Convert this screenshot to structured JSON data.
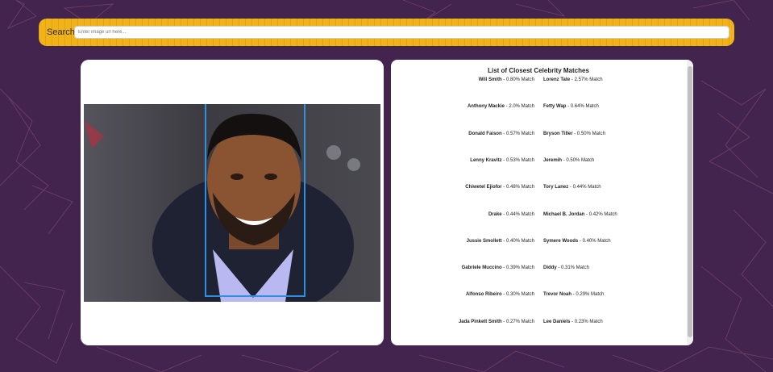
{
  "search": {
    "label": "Search",
    "placeholder": "Enter image url here..."
  },
  "photo": {
    "description_icon": "face-photo"
  },
  "results": {
    "title": "List of Closest Celebrity Matches",
    "rows": [
      [
        {
          "name": "Will Smith",
          "score": " - 0.80% Match"
        },
        {
          "name": "Lorenz Tate",
          "score": " - 2.57% Match"
        }
      ],
      [
        {
          "name": "Anthony Mackie",
          "score": " - 2.0% Match"
        },
        {
          "name": "Fetty Wap",
          "score": " - 0.64% Match"
        }
      ],
      [
        {
          "name": "Donald Faison",
          "score": " - 0.57% Match"
        },
        {
          "name": "Bryson Tiller",
          "score": " - 0.50% Match"
        }
      ],
      [
        {
          "name": "Lenny Kravitz",
          "score": " - 0.53% Match"
        },
        {
          "name": "Jeremih",
          "score": " - 0.50% Match"
        }
      ],
      [
        {
          "name": "Chiwetel Ejiofor",
          "score": " - 0.48% Match"
        },
        {
          "name": "Tory Lanez",
          "score": " - 0.44% Match"
        }
      ],
      [
        {
          "name": "Drake",
          "score": " - 0.44% Match"
        },
        {
          "name": "Michael B. Jordan",
          "score": " - 0.42% Match"
        }
      ],
      [
        {
          "name": "Jussie Smollett",
          "score": " - 0.40% Match"
        },
        {
          "name": "Symere Woods",
          "score": " - 0.40% Match"
        }
      ],
      [
        {
          "name": "Gabriele Muccino",
          "score": " - 0.39% Match"
        },
        {
          "name": "Diddy",
          "score": " - 0.31% Match"
        }
      ],
      [
        {
          "name": "Alfonso Ribeiro",
          "score": " - 0.30% Match"
        },
        {
          "name": "Trevor Noah",
          "score": " - 0.29% Match"
        }
      ],
      [
        {
          "name": "Jada Pinkett Smith",
          "score": " - 0.27% Match"
        },
        {
          "name": "Lee Daniels",
          "score": " - 0.23% Match"
        }
      ]
    ]
  },
  "colors": {
    "background": "#43244e",
    "search_bar": "#f2b319",
    "face_box": "#2e90e0"
  }
}
